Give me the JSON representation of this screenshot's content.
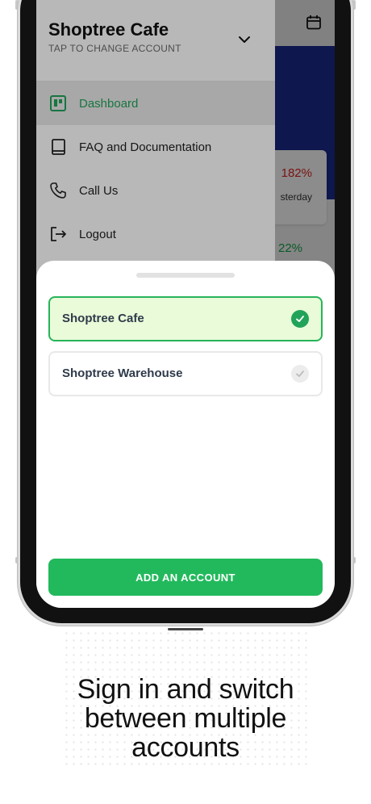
{
  "drawer": {
    "account_name": "Shoptree Cafe",
    "account_hint": "TAP TO CHANGE ACCOUNT",
    "menu": [
      {
        "label": "Dashboard",
        "icon": "dashboard-icon",
        "active": true
      },
      {
        "label": "FAQ and Documentation",
        "icon": "book-icon",
        "active": false
      },
      {
        "label": "Call Us",
        "icon": "phone-icon",
        "active": false
      },
      {
        "label": "Logout",
        "icon": "logout-icon",
        "active": false
      }
    ]
  },
  "background_app": {
    "stat_change": "182%",
    "stat_label": "sterday",
    "stat_change_2": "22%"
  },
  "account_sheet": {
    "accounts": [
      {
        "name": "Shoptree Cafe",
        "selected": true
      },
      {
        "name": "Shoptree Warehouse",
        "selected": false
      }
    ],
    "add_button_label": "ADD AN ACCOUNT"
  },
  "caption": {
    "line1": "Sign in and switch",
    "line2": "between multiple",
    "line3": "accounts"
  },
  "colors": {
    "accent_green": "#22b95c",
    "selected_bg": "#e9fbd9",
    "header_blue": "#1b2a8f",
    "negative_red": "#e02424"
  }
}
